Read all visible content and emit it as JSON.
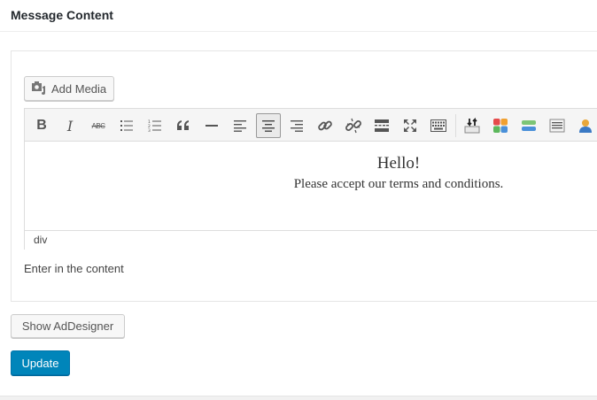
{
  "box": {
    "title": "Message Content"
  },
  "media": {
    "add_label": "Add Media"
  },
  "toolbar": {
    "bold": "B",
    "italic": "I",
    "strike": "ABC",
    "quote": "“",
    "buttons": [
      "bold-icon",
      "italic-icon",
      "strikethrough-icon",
      "bullet-list-icon",
      "numbered-list-icon",
      "blockquote-icon",
      "horizontal-line-icon",
      "align-left-icon",
      "align-center-icon",
      "align-right-icon",
      "link-icon",
      "unlink-icon",
      "read-more-icon",
      "fullscreen-icon",
      "toolbar-toggle-icon",
      "shortcode-insert-icon",
      "widgets-icon",
      "block-icon",
      "form-icon",
      "user-icon"
    ],
    "active": "align-center-icon"
  },
  "editor": {
    "heading": "Hello!",
    "paragraph": "Please accept our terms and conditions.",
    "path": "div"
  },
  "field": {
    "description": "Enter in the content"
  },
  "actions": {
    "show_designer": "Show AdDesigner",
    "update": "Update"
  },
  "colors": {
    "primary": "#0085ba",
    "primary_border": "#0073aa"
  }
}
